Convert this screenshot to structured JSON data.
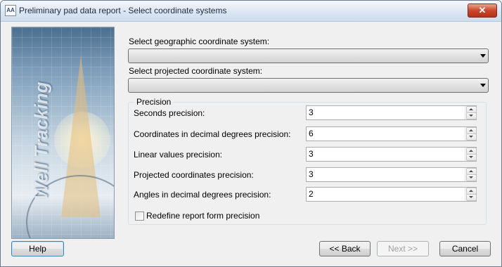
{
  "window": {
    "icon": "app-icon",
    "icon_glyph": "AA",
    "title": "Preliminary pad data report - Select coordinate systems",
    "close_glyph": "✕"
  },
  "banner": {
    "text": "Well Tracking"
  },
  "geographic": {
    "label": "Select geographic coordinate system:",
    "value": ""
  },
  "projected": {
    "label": "Select projected coordinate system:",
    "value": ""
  },
  "precision": {
    "group_title": "Precision",
    "fields": [
      {
        "label": "Seconds precision:",
        "value": "3"
      },
      {
        "label": "Coordinates in decimal degrees  precision:",
        "value": "6"
      },
      {
        "label": "Linear values precision:",
        "value": "3"
      },
      {
        "label": "Projected coordinates precision:",
        "value": "3"
      },
      {
        "label": "Angles in decimal degrees precision:",
        "value": "2"
      }
    ],
    "redefine_label": "Redefine report form precision",
    "redefine_checked": false
  },
  "buttons": {
    "help": "Help",
    "back": "<< Back",
    "next": "Next >>",
    "cancel": "Cancel"
  }
}
